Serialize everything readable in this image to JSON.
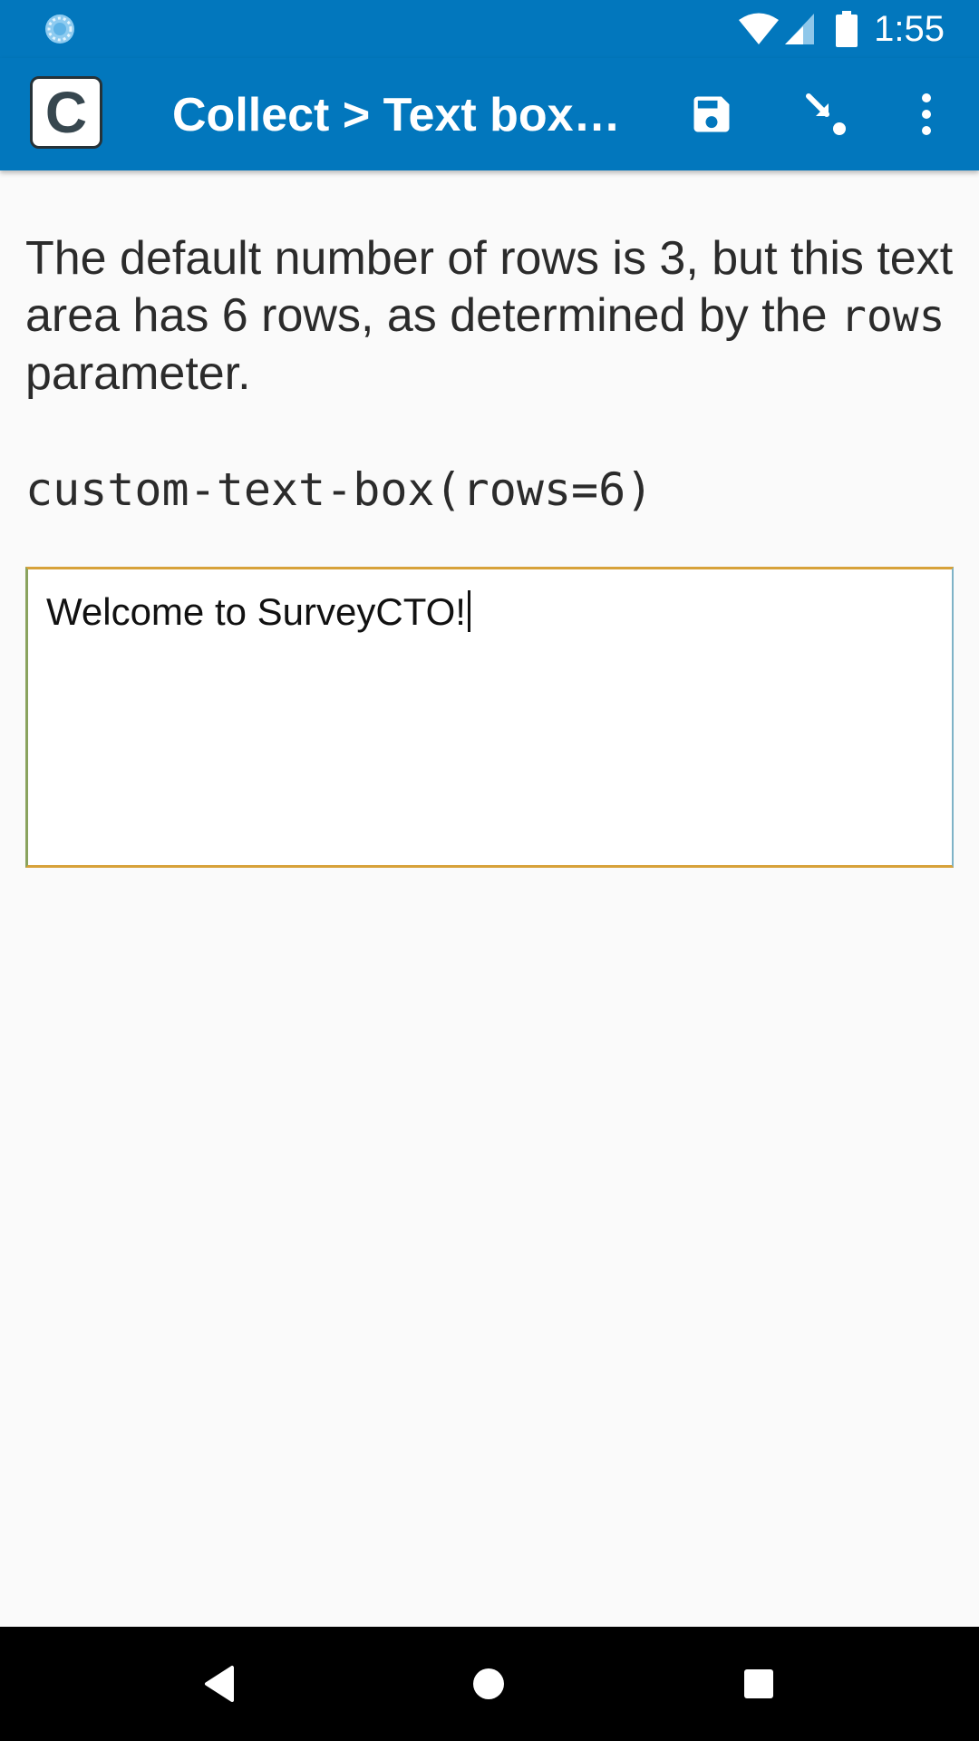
{
  "status_bar": {
    "time": "1:55",
    "loader_icon": "sync-loader-icon",
    "wifi_icon": "wifi-icon",
    "cell_icon": "cell-signal-icon",
    "battery_icon": "battery-icon"
  },
  "app_bar": {
    "logo_letter": "C",
    "title": "Collect > Text box…",
    "save_icon": "save-icon",
    "jump_icon": "jump-to-question-icon",
    "more_icon": "more-vert-icon"
  },
  "question": {
    "text_before": "The default number of rows is 3, but this text area has 6 rows, as determined by the ",
    "code_word": "rows",
    "text_after": " parameter.",
    "appearance": "custom-text-box(rows=6)"
  },
  "answer": {
    "value": "Welcome to SurveyCTO!"
  },
  "nav_bar": {
    "back_icon": "back-triangle-icon",
    "home_icon": "home-circle-icon",
    "recents_icon": "recents-square-icon"
  },
  "colors": {
    "app_bar": "#0277bd",
    "background": "#fafafa",
    "nav_bar": "#000000"
  }
}
